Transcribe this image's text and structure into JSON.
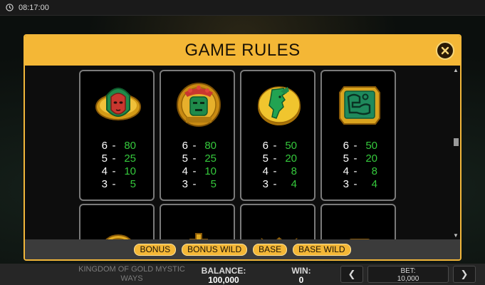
{
  "status_bar": {
    "time": "08:17:00"
  },
  "modal": {
    "title": "GAME RULES",
    "symbols": [
      {
        "icon": "red-mask-icon",
        "payouts": [
          {
            "count": "6",
            "value": "80"
          },
          {
            "count": "5",
            "value": "25"
          },
          {
            "count": "4",
            "value": "10"
          },
          {
            "count": "3",
            "value": "5"
          }
        ]
      },
      {
        "icon": "green-idol-icon",
        "payouts": [
          {
            "count": "6",
            "value": "80"
          },
          {
            "count": "5",
            "value": "25"
          },
          {
            "count": "4",
            "value": "10"
          },
          {
            "count": "3",
            "value": "5"
          }
        ]
      },
      {
        "icon": "jade-profile-coin-icon",
        "payouts": [
          {
            "count": "6",
            "value": "50"
          },
          {
            "count": "5",
            "value": "20"
          },
          {
            "count": "4",
            "value": "8"
          },
          {
            "count": "3",
            "value": "4"
          }
        ]
      },
      {
        "icon": "jade-glyph-tile-icon",
        "payouts": [
          {
            "count": "6",
            "value": "50"
          },
          {
            "count": "5",
            "value": "20"
          },
          {
            "count": "4",
            "value": "8"
          },
          {
            "count": "3",
            "value": "4"
          }
        ]
      }
    ],
    "tabs": [
      "BONUS",
      "BONUS WILD",
      "BASE",
      "BASE WILD"
    ]
  },
  "game_bar": {
    "game_name": "KINGDOM OF GOLD MYSTIC WAYS",
    "balance_label": "BALANCE:",
    "balance_value": "100,000",
    "win_label": "WIN:",
    "win_value": "0",
    "bet_label": "BET:",
    "bet_value": "10,000",
    "prev_arrow": "❮",
    "next_arrow": "❯"
  },
  "colors": {
    "accent": "#f4b736",
    "payout_value": "#35c93c",
    "card_border": "#7a7a7a"
  }
}
